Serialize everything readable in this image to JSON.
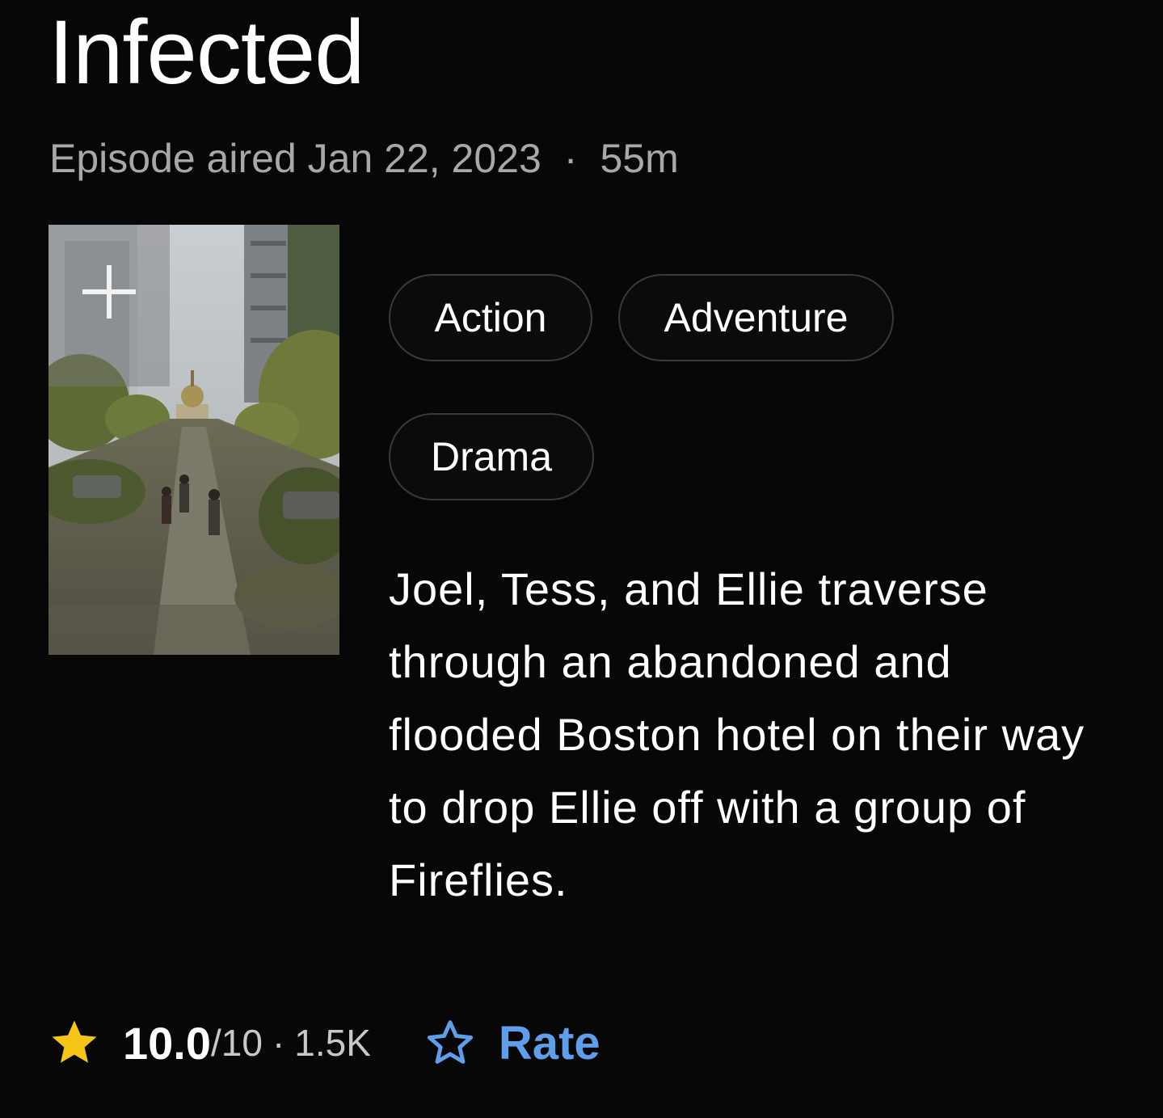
{
  "episode": {
    "title": "Infected",
    "aired_label": "Episode aired Jan 22, 2023",
    "separator": "·",
    "runtime": "55m"
  },
  "genres": [
    "Action",
    "Adventure",
    "Drama"
  ],
  "plot": "Joel, Tess, and Ellie traverse through an abandoned and flooded Boston hotel on their way to drop Ellie off with a group of Fireflies.",
  "rating": {
    "value": "10.0",
    "max": "/10",
    "separator": "·",
    "count": "1.5K",
    "star_icon": "star-icon",
    "star_color": "#f5c518"
  },
  "rate_button": {
    "label": "Rate",
    "icon": "outline-star-icon",
    "color": "#5f9eea"
  },
  "poster": {
    "watchlist_icon": "plus-icon"
  }
}
